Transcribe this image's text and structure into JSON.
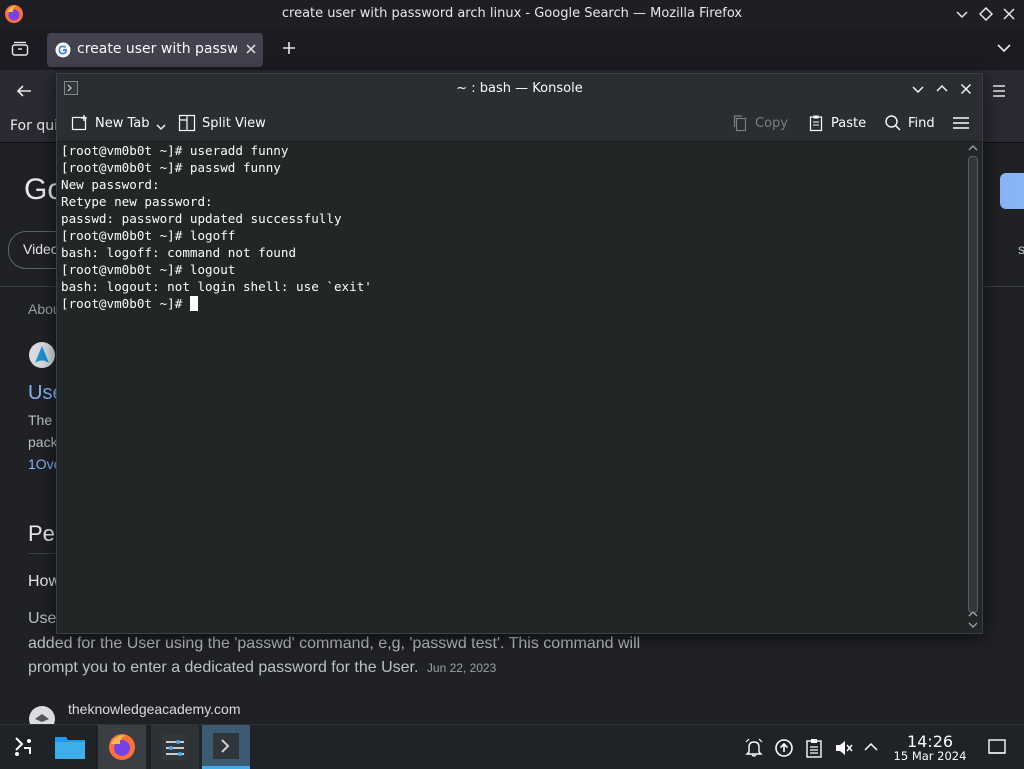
{
  "firefox": {
    "window_title": "create user with password arch linux - Google Search — Mozilla Firefox",
    "tab_title": "create user with password arch linux - Google Search",
    "bookmark_text": "For qui",
    "page": {
      "logo_fragment": "Go",
      "chip_fragment": "Video",
      "about_fragment": "Abou",
      "result_title_fragment": "Use",
      "snippet_line1_fragment": "The",
      "snippet_line2_fragment": "pack",
      "link_fragment": "1Ove",
      "section_heading_fragment": "Pe",
      "question_fragment": "How",
      "answer_line1_fragment": "Use",
      "answer_line2": "added for the User using the 'passwd' command, e,g, 'passwd test'. This command will",
      "answer_line3": "prompt you to enter a dedicated password for the User.",
      "answer_date": "Jun 22, 2023",
      "source_site": "theknowledgeacademy.com",
      "right_fragment": "s"
    }
  },
  "konsole": {
    "title": "~ : bash — Konsole",
    "toolbar": {
      "new_tab": "New Tab",
      "split_view": "Split View",
      "copy": "Copy",
      "paste": "Paste",
      "find": "Find"
    },
    "terminal_lines": [
      "[root@vm0b0t ~]# useradd funny",
      "[root@vm0b0t ~]# passwd funny",
      "New password:",
      "Retype new password:",
      "passwd: password updated successfully",
      "[root@vm0b0t ~]# logoff",
      "bash: logoff: command not found",
      "[root@vm0b0t ~]# logout",
      "bash: logout: not login shell: use `exit'",
      "[root@vm0b0t ~]# "
    ]
  },
  "taskbar": {
    "apps": [
      "application-launcher-icon",
      "dolphin-icon",
      "firefox-icon",
      "system-settings-icon",
      "konsole-icon"
    ],
    "clock_time": "14:26",
    "clock_date": "15 Mar 2024"
  },
  "colors": {
    "accent": "#3daee9",
    "google_link": "#8ab4f8",
    "terminal_bg": "#232627"
  }
}
